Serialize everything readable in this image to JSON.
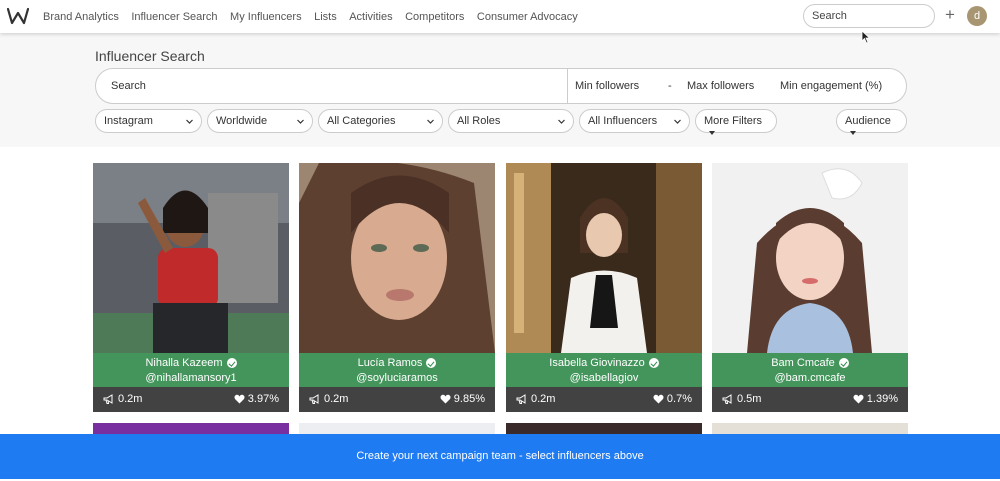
{
  "nav": {
    "items": [
      "Brand Analytics",
      "Influencer Search",
      "My Influencers",
      "Lists",
      "Activities",
      "Competitors",
      "Consumer Advocacy"
    ],
    "search_placeholder": "Search",
    "avatar_initial": "d"
  },
  "search": {
    "title": "Influencer Search",
    "query_placeholder": "Search",
    "min_followers": "Min followers",
    "dash": "-",
    "max_followers": "Max followers",
    "min_engagement": "Min engagement (%)"
  },
  "filters": {
    "platform": "Instagram",
    "location": "Worldwide",
    "category": "All Categories",
    "role": "All Roles",
    "influencers": "All Influencers",
    "more": "More Filters",
    "audience": "Audience"
  },
  "influencers": [
    {
      "name": "Nihalla Kazeem",
      "handle": "@nihallamansory1",
      "followers": "0.2m",
      "engagement": "3.97%"
    },
    {
      "name": "Lucía Ramos",
      "handle": "@soyluciaramos",
      "followers": "0.2m",
      "engagement": "9.85%"
    },
    {
      "name": "Isabella Giovinazzo",
      "handle": "@isabellagiov",
      "followers": "0.2m",
      "engagement": "0.7%"
    },
    {
      "name": "Bam Cmcafe",
      "handle": "@bam.cmcafe",
      "followers": "0.5m",
      "engagement": "1.39%"
    }
  ],
  "cta": "Create your next campaign team - select influencers above",
  "colors": {
    "accent_blue": "#1f7bf2",
    "name_band_green": "#348c4e",
    "avatar": "#a89673"
  }
}
